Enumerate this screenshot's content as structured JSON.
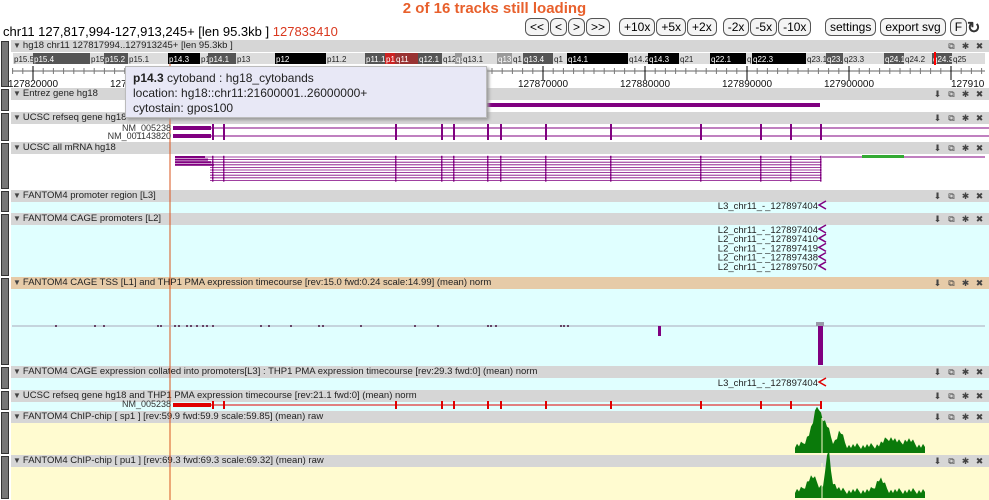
{
  "status": "2 of 16 tracks still loading",
  "location": {
    "text": "chr11 127,817,994-127,913,245+ [len 95.3kb ]",
    "highlight": "127833410"
  },
  "nav": [
    "<<",
    "<",
    ">",
    ">>"
  ],
  "zoom": [
    "+10x",
    "+5x",
    "+2x",
    "-2x",
    "-5x",
    "-10x"
  ],
  "settings": "settings",
  "export": "export svg",
  "f_label": "F",
  "ruler": {
    "title": "hg18 chr11 127817994..127913245+ [len 95.3kb ]",
    "start": 127817994,
    "end": 127913245,
    "ticks": [
      "127820000",
      "127830000",
      "127840000",
      "127850000",
      "127860000",
      "127870000",
      "127880000",
      "127890000",
      "127900000",
      "127910"
    ]
  },
  "cytobands": [
    [
      "p15.5",
      "l"
    ],
    [
      "p15.4",
      "g"
    ],
    [
      "p15",
      "l"
    ],
    [
      "p15.2",
      "g"
    ],
    [
      "p15.1",
      "l"
    ],
    [
      "p14.3",
      "b"
    ],
    [
      "p1",
      "l"
    ],
    [
      "p14.1",
      "g"
    ],
    [
      "p13",
      "l"
    ],
    [
      "p12",
      "b"
    ],
    [
      "p11.2",
      "l"
    ],
    [
      "p11.1",
      "g"
    ],
    [
      "p1",
      "r"
    ],
    [
      "q11",
      "dr"
    ],
    [
      "q12.1",
      "g"
    ],
    [
      "q12",
      "l"
    ],
    [
      "q1",
      "m"
    ],
    [
      "q13.1",
      "l"
    ],
    [
      "q13",
      "m"
    ],
    [
      "q1",
      "l"
    ],
    [
      "q13.4",
      "g"
    ],
    [
      "q1",
      "l"
    ],
    [
      "q14.1",
      "b"
    ],
    [
      "q14.2",
      "l"
    ],
    [
      "q14.3",
      "b"
    ],
    [
      "q21",
      "l"
    ],
    [
      "q22.1",
      "b"
    ],
    [
      "q",
      "l"
    ],
    [
      "q22.3",
      "b"
    ],
    [
      "q23.1",
      "l"
    ],
    [
      "q23.2",
      "g"
    ],
    [
      "q23.3",
      "l"
    ],
    [
      "q24.1",
      "g"
    ],
    [
      "q24.2",
      "l"
    ],
    [
      "q24.3",
      "g"
    ],
    [
      "q25",
      "l"
    ]
  ],
  "tooltip": {
    "band": "p14.3",
    "title": " cytoband : hg18_cytobands",
    "location": "location: hg18::chr11:21600001..26000000+",
    "stain": "cytostain: gpos100"
  },
  "tracks": [
    {
      "title": "Entrez gene hg18"
    },
    {
      "title": "UCSC refseq gene hg18",
      "labels": [
        "NM_005238",
        "NM_001143820"
      ]
    },
    {
      "title": "UCSC all mRNA hg18"
    },
    {
      "title": "FANTOM4 promoter region [L3]",
      "labels": [
        "L3_chr11_-_127897404"
      ]
    },
    {
      "title": "FANTOM4 CAGE promoters [L2]",
      "labels": [
        "L2_chr11_-_127897404",
        "L2_chr11_-_127897410",
        "L2_chr11_-_127897419",
        "L2_chr11_-_127897438",
        "L2_chr11_-_127897507"
      ]
    },
    {
      "title": "FANTOM4 CAGE TSS [L1] and THP1 PMA expression timecourse [rev:15.0 fwd:0.24 scale:14.99] (mean) norm"
    },
    {
      "title": "FANTOM4 CAGE expression collated into promoters[L3] : THP1 PMA expression timecourse [rev:29.3 fwd:0] (mean) norm",
      "labels": [
        "L3_chr11_-_127897404"
      ]
    },
    {
      "title": "UCSC refseq gene hg18 and THP1 PMA expression timecourse [rev:21.1 fwd:0] (mean) norm",
      "labels": [
        "NM_005238"
      ]
    },
    {
      "title": "FANTOM4 ChIP-chip [ sp1 ] [rev:59.9 fwd:59.9 scale:59.85] (mean) raw"
    },
    {
      "title": "FANTOM4 ChIP-chip [ pu1 ] [rev:69.3 fwd:69.3 scale:69.32] (mean) raw"
    }
  ],
  "colors": {
    "accent": "#e8602c",
    "gene": "#800080",
    "refexpr": "#e00000",
    "chip": "#0a7a0a",
    "cursor": "#d9541e"
  }
}
